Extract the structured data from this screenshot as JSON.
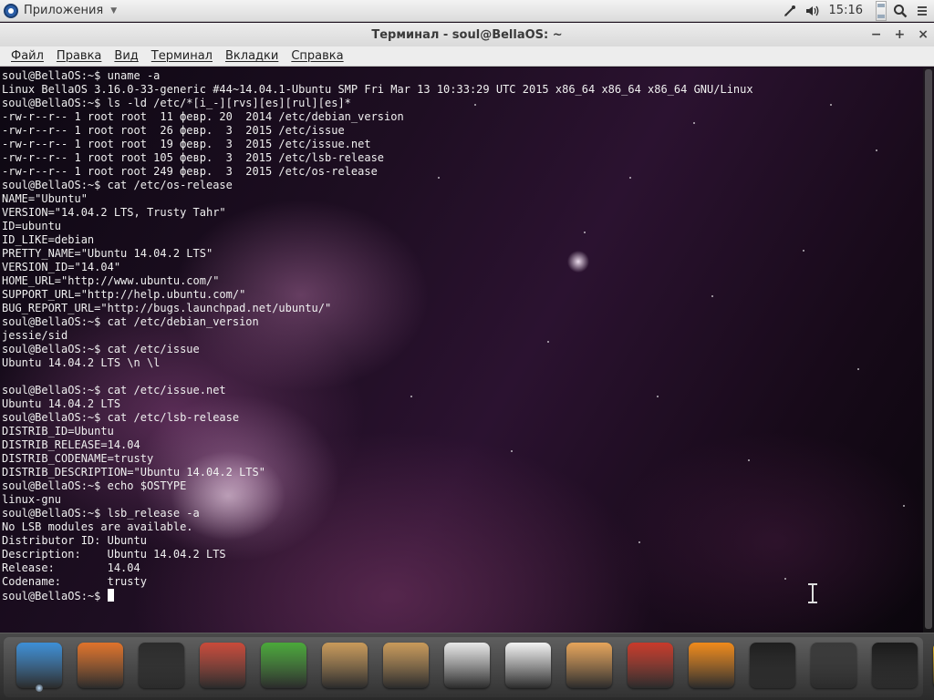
{
  "top_panel": {
    "apps_label": "Приложения",
    "clock": "15:16",
    "icons": [
      "network-icon",
      "volume-icon",
      "search-icon"
    ]
  },
  "window": {
    "title": "Терминал - soul@BellaOS: ~",
    "controls": [
      "minimize-icon",
      "maximize-icon",
      "close-icon"
    ]
  },
  "menu": {
    "items": [
      "Файл",
      "Правка",
      "Вид",
      "Терминал",
      "Вкладки",
      "Справка"
    ]
  },
  "terminal": {
    "lines": [
      "soul@BellaOS:~$ uname -a",
      "Linux BellaOS 3.16.0-33-generic #44~14.04.1-Ubuntu SMP Fri Mar 13 10:33:29 UTC 2015 x86_64 x86_64 x86_64 GNU/Linux",
      "soul@BellaOS:~$ ls -ld /etc/*[i_-][rvs][es][rul][es]*",
      "-rw-r--r-- 1 root root  11 февр. 20  2014 /etc/debian_version",
      "-rw-r--r-- 1 root root  26 февр.  3  2015 /etc/issue",
      "-rw-r--r-- 1 root root  19 февр.  3  2015 /etc/issue.net",
      "-rw-r--r-- 1 root root 105 февр.  3  2015 /etc/lsb-release",
      "-rw-r--r-- 1 root root 249 февр.  3  2015 /etc/os-release",
      "soul@BellaOS:~$ cat /etc/os-release",
      "NAME=\"Ubuntu\"",
      "VERSION=\"14.04.2 LTS, Trusty Tahr\"",
      "ID=ubuntu",
      "ID_LIKE=debian",
      "PRETTY_NAME=\"Ubuntu 14.04.2 LTS\"",
      "VERSION_ID=\"14.04\"",
      "HOME_URL=\"http://www.ubuntu.com/\"",
      "SUPPORT_URL=\"http://help.ubuntu.com/\"",
      "BUG_REPORT_URL=\"http://bugs.launchpad.net/ubuntu/\"",
      "soul@BellaOS:~$ cat /etc/debian_version",
      "jessie/sid",
      "soul@BellaOS:~$ cat /etc/issue",
      "Ubuntu 14.04.2 LTS \\n \\l",
      "",
      "soul@BellaOS:~$ cat /etc/issue.net",
      "Ubuntu 14.04.2 LTS",
      "soul@BellaOS:~$ cat /etc/lsb-release",
      "DISTRIB_ID=Ubuntu",
      "DISTRIB_RELEASE=14.04",
      "DISTRIB_CODENAME=trusty",
      "DISTRIB_DESCRIPTION=\"Ubuntu 14.04.2 LTS\"",
      "soul@BellaOS:~$ echo $OSTYPE",
      "linux-gnu",
      "soul@BellaOS:~$ lsb_release -a",
      "No LSB modules are available.",
      "Distributor ID: Ubuntu",
      "Description:    Ubuntu 14.04.2 LTS",
      "Release:        14.04",
      "Codename:       trusty"
    ],
    "prompt": "soul@BellaOS:~$ "
  },
  "dock": {
    "apps": [
      {
        "name": "anchor-icon",
        "color": "#3d8fd6"
      },
      {
        "name": "firefox-icon",
        "color": "#e0732a"
      },
      {
        "name": "terminal-icon",
        "color": "#2b2b2b"
      },
      {
        "name": "archive-manager-icon",
        "color": "#c94a3a"
      },
      {
        "name": "passwords-keys-icon",
        "color": "#4aa83a"
      },
      {
        "name": "package-installer-icon",
        "color": "#c99a5a"
      },
      {
        "name": "package-download-icon",
        "color": "#c99a5a"
      },
      {
        "name": "document-viewer-icon",
        "color": "#e8e8e8"
      },
      {
        "name": "text-editor-icon",
        "color": "#f2f2f2"
      },
      {
        "name": "paint-icon",
        "color": "#e6a45a"
      },
      {
        "name": "disc-burner-icon",
        "color": "#c83a2a"
      },
      {
        "name": "vlc-icon",
        "color": "#f08a1a"
      },
      {
        "name": "video-player-icon",
        "color": "#1e1e1e"
      },
      {
        "name": "webcam-icon",
        "color": "#3a3a3a"
      },
      {
        "name": "system-monitor-icon",
        "color": "#1a1a1a"
      },
      {
        "name": "bella-icon",
        "color": "#f2c020"
      }
    ]
  }
}
